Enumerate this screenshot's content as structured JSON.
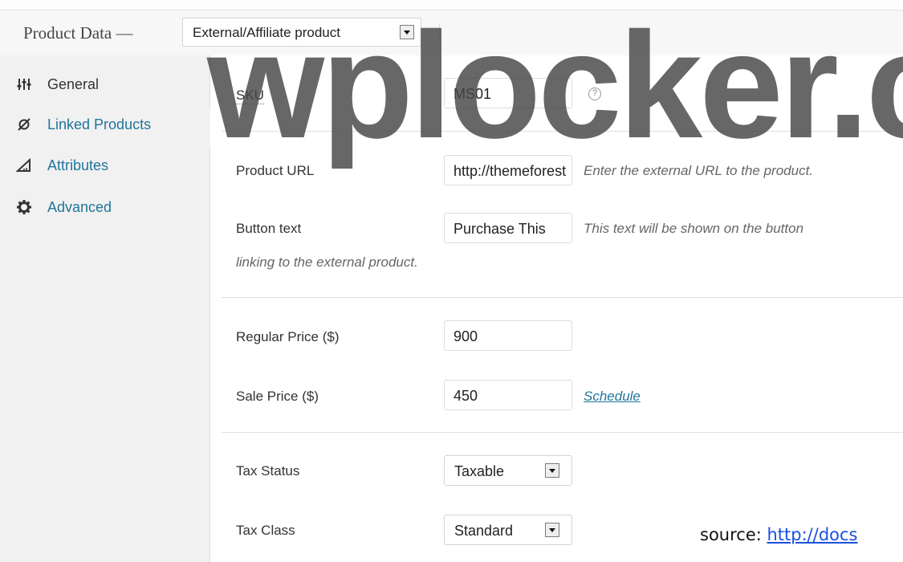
{
  "header": {
    "title": "Product Data —",
    "product_type": "External/Affiliate product"
  },
  "sidebar": {
    "items": [
      {
        "label": "General",
        "icon": "sliders-icon"
      },
      {
        "label": "Linked Products",
        "icon": "link-icon"
      },
      {
        "label": "Attributes",
        "icon": "ruler-icon"
      },
      {
        "label": "Advanced",
        "icon": "gear-icon"
      }
    ]
  },
  "fields": {
    "sku": {
      "label": "SKU",
      "value": "MS01",
      "help": "?"
    },
    "product_url": {
      "label": "Product URL",
      "value": "http://themeforest",
      "description": "Enter the external URL to the product."
    },
    "button_text": {
      "label": "Button text",
      "value": "Purchase This",
      "description_line1": "This text will be shown on the button",
      "description_line2": "linking to the external product."
    },
    "regular_price": {
      "label": "Regular Price ($)",
      "value": "900"
    },
    "sale_price": {
      "label": "Sale Price ($)",
      "value": "450",
      "link": "Schedule"
    },
    "tax_status": {
      "label": "Tax Status",
      "value": "Taxable"
    },
    "tax_class": {
      "label": "Tax Class",
      "value": "Standard"
    }
  },
  "watermark": "wplocker.c",
  "source": {
    "prefix": "source: ",
    "link": "http://docs"
  },
  "colors": {
    "link": "#21759b",
    "sidebar_bg": "#f1f1f1",
    "header_bg": "#f7f7f7"
  }
}
